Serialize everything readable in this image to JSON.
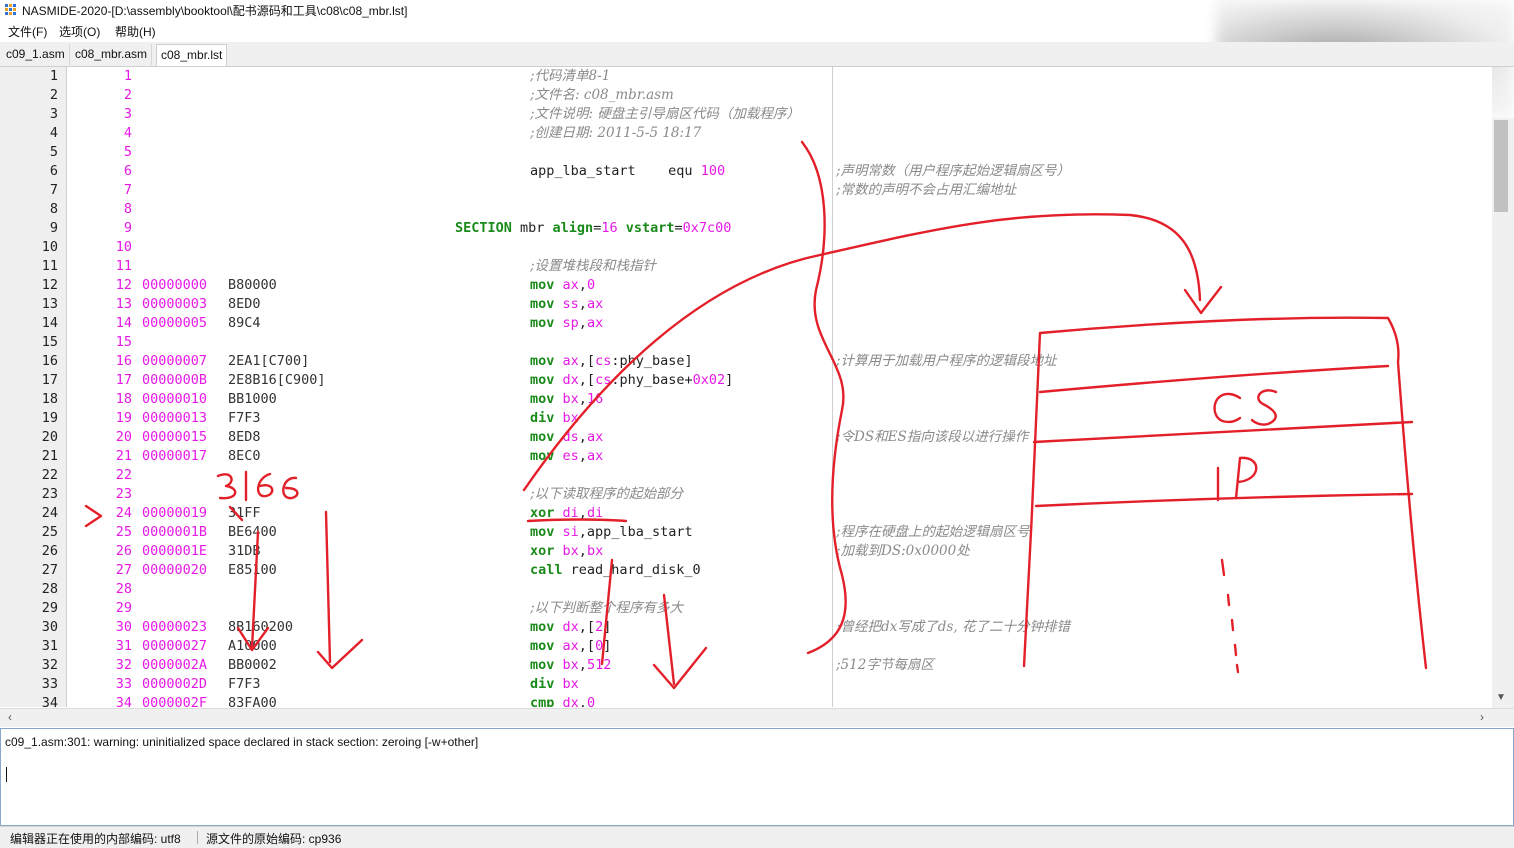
{
  "window": {
    "title": "NASMIDE-2020-[D:\\assembly\\booktool\\配书源码和工具\\c08\\c08_mbr.lst]"
  },
  "menu": [
    {
      "label": "文件(F)"
    },
    {
      "label": "选项(O)"
    },
    {
      "label": "帮助(H)"
    }
  ],
  "tabs": [
    {
      "label": "c09_1.asm",
      "active": false
    },
    {
      "label": "c08_mbr.asm",
      "active": false
    },
    {
      "label": "c08_mbr.lst",
      "active": true
    }
  ],
  "listing": [
    {
      "n": "1",
      "ln": "1",
      "addr": "",
      "hex": "",
      "src": [
        {
          "t": ";代码清单8-1",
          "c": "cm"
        }
      ],
      "cmt": ""
    },
    {
      "n": "2",
      "ln": "2",
      "addr": "",
      "hex": "",
      "src": [
        {
          "t": ";文件名: c08_mbr.asm",
          "c": "cm"
        }
      ],
      "cmt": ""
    },
    {
      "n": "3",
      "ln": "3",
      "addr": "",
      "hex": "",
      "src": [
        {
          "t": ";文件说明: 硬盘主引导扇区代码（加载程序）",
          "c": "cm"
        }
      ],
      "cmt": ""
    },
    {
      "n": "4",
      "ln": "4",
      "addr": "",
      "hex": "",
      "src": [
        {
          "t": ";创建日期: 2011-5-5 18:17",
          "c": "cm"
        }
      ],
      "cmt": ""
    },
    {
      "n": "5",
      "ln": "5",
      "addr": "",
      "hex": "",
      "src": [],
      "cmt": ""
    },
    {
      "n": "6",
      "ln": "6",
      "addr": "",
      "hex": "",
      "src": [
        {
          "t": "app_lba_start    equ ",
          "c": "tx"
        },
        {
          "t": "100",
          "c": "nm"
        }
      ],
      "cmt": ";声明常数（用户程序起始逻辑扇区号）"
    },
    {
      "n": "7",
      "ln": "7",
      "addr": "",
      "hex": "",
      "src": [],
      "cmt": ";常数的声明不会占用汇编地址"
    },
    {
      "n": "8",
      "ln": "8",
      "addr": "",
      "hex": "",
      "src": [],
      "cmt": ""
    },
    {
      "n": "9",
      "ln": "9",
      "addr": "",
      "hex": "",
      "src": [
        {
          "t": "SECTION",
          "c": "kw"
        },
        {
          "t": " mbr ",
          "c": "tx"
        },
        {
          "t": "align",
          "c": "kw"
        },
        {
          "t": "=",
          "c": "tx"
        },
        {
          "t": "16",
          "c": "nm"
        },
        {
          "t": " ",
          "c": "tx"
        },
        {
          "t": "vstart",
          "c": "kw"
        },
        {
          "t": "=",
          "c": "tx"
        },
        {
          "t": "0x7c00",
          "c": "nm"
        }
      ],
      "cmt": "",
      "section": true
    },
    {
      "n": "10",
      "ln": "10",
      "addr": "",
      "hex": "",
      "src": [],
      "cmt": ""
    },
    {
      "n": "11",
      "ln": "11",
      "addr": "",
      "hex": "",
      "src": [
        {
          "t": ";设置堆栈段和栈指针",
          "c": "cm"
        }
      ],
      "cmt": ""
    },
    {
      "n": "12",
      "ln": "12",
      "addr": "00000000",
      "hex": "B80000",
      "src": [
        {
          "t": "mov",
          "c": "kw"
        },
        {
          "t": " ",
          "c": "tx"
        },
        {
          "t": "ax",
          "c": "rg"
        },
        {
          "t": ",",
          "c": "tx"
        },
        {
          "t": "0",
          "c": "nm"
        }
      ],
      "cmt": ""
    },
    {
      "n": "13",
      "ln": "13",
      "addr": "00000003",
      "hex": "8ED0",
      "src": [
        {
          "t": "mov",
          "c": "kw"
        },
        {
          "t": " ",
          "c": "tx"
        },
        {
          "t": "ss",
          "c": "rg"
        },
        {
          "t": ",",
          "c": "tx"
        },
        {
          "t": "ax",
          "c": "rg"
        }
      ],
      "cmt": ""
    },
    {
      "n": "14",
      "ln": "14",
      "addr": "00000005",
      "hex": "89C4",
      "src": [
        {
          "t": "mov",
          "c": "kw"
        },
        {
          "t": " ",
          "c": "tx"
        },
        {
          "t": "sp",
          "c": "rg"
        },
        {
          "t": ",",
          "c": "tx"
        },
        {
          "t": "ax",
          "c": "rg"
        }
      ],
      "cmt": ""
    },
    {
      "n": "15",
      "ln": "15",
      "addr": "",
      "hex": "",
      "src": [],
      "cmt": ""
    },
    {
      "n": "16",
      "ln": "16",
      "addr": "00000007",
      "hex": "2EA1[C700]",
      "src": [
        {
          "t": "mov",
          "c": "kw"
        },
        {
          "t": " ",
          "c": "tx"
        },
        {
          "t": "ax",
          "c": "rg"
        },
        {
          "t": ",[",
          "c": "tx"
        },
        {
          "t": "cs",
          "c": "rg"
        },
        {
          "t": ":phy_base]",
          "c": "tx"
        }
      ],
      "cmt": ";计算用于加载用户程序的逻辑段地址"
    },
    {
      "n": "17",
      "ln": "17",
      "addr": "0000000B",
      "hex": "2E8B16[C900]",
      "src": [
        {
          "t": "mov",
          "c": "kw"
        },
        {
          "t": " ",
          "c": "tx"
        },
        {
          "t": "dx",
          "c": "rg"
        },
        {
          "t": ",[",
          "c": "tx"
        },
        {
          "t": "cs",
          "c": "rg"
        },
        {
          "t": ":phy_base+",
          "c": "tx"
        },
        {
          "t": "0x02",
          "c": "nm"
        },
        {
          "t": "]",
          "c": "tx"
        }
      ],
      "cmt": ""
    },
    {
      "n": "18",
      "ln": "18",
      "addr": "00000010",
      "hex": "BB1000",
      "src": [
        {
          "t": "mov",
          "c": "kw"
        },
        {
          "t": " ",
          "c": "tx"
        },
        {
          "t": "bx",
          "c": "rg"
        },
        {
          "t": ",",
          "c": "tx"
        },
        {
          "t": "16",
          "c": "nm"
        }
      ],
      "cmt": ""
    },
    {
      "n": "19",
      "ln": "19",
      "addr": "00000013",
      "hex": "F7F3",
      "src": [
        {
          "t": "div",
          "c": "kw"
        },
        {
          "t": " ",
          "c": "tx"
        },
        {
          "t": "bx",
          "c": "rg"
        }
      ],
      "cmt": ""
    },
    {
      "n": "20",
      "ln": "20",
      "addr": "00000015",
      "hex": "8ED8",
      "src": [
        {
          "t": "mov",
          "c": "kw"
        },
        {
          "t": " ",
          "c": "tx"
        },
        {
          "t": "ds",
          "c": "rg"
        },
        {
          "t": ",",
          "c": "tx"
        },
        {
          "t": "ax",
          "c": "rg"
        }
      ],
      "cmt": ";令DS和ES指向该段以进行操作"
    },
    {
      "n": "21",
      "ln": "21",
      "addr": "00000017",
      "hex": "8EC0",
      "src": [
        {
          "t": "mov",
          "c": "kw"
        },
        {
          "t": " ",
          "c": "tx"
        },
        {
          "t": "es",
          "c": "rg"
        },
        {
          "t": ",",
          "c": "tx"
        },
        {
          "t": "ax",
          "c": "rg"
        }
      ],
      "cmt": ""
    },
    {
      "n": "22",
      "ln": "22",
      "addr": "",
      "hex": "",
      "src": [],
      "cmt": ""
    },
    {
      "n": "23",
      "ln": "23",
      "addr": "",
      "hex": "",
      "src": [
        {
          "t": ";以下读取程序的起始部分",
          "c": "cm"
        }
      ],
      "cmt": ""
    },
    {
      "n": "24",
      "ln": "24",
      "addr": "00000019",
      "hex": "31FF",
      "src": [
        {
          "t": "xor",
          "c": "kw"
        },
        {
          "t": " ",
          "c": "tx"
        },
        {
          "t": "di",
          "c": "rg"
        },
        {
          "t": ",",
          "c": "tx"
        },
        {
          "t": "di",
          "c": "rg"
        }
      ],
      "cmt": ""
    },
    {
      "n": "25",
      "ln": "25",
      "addr": "0000001B",
      "hex": "BE6400",
      "src": [
        {
          "t": "mov",
          "c": "kw"
        },
        {
          "t": " ",
          "c": "tx"
        },
        {
          "t": "si",
          "c": "rg"
        },
        {
          "t": ",app_lba_start",
          "c": "tx"
        }
      ],
      "cmt": ";程序在硬盘上的起始逻辑扇区号"
    },
    {
      "n": "26",
      "ln": "26",
      "addr": "0000001E",
      "hex": "31DB",
      "src": [
        {
          "t": "xor",
          "c": "kw"
        },
        {
          "t": " ",
          "c": "tx"
        },
        {
          "t": "bx",
          "c": "rg"
        },
        {
          "t": ",",
          "c": "tx"
        },
        {
          "t": "bx",
          "c": "rg"
        }
      ],
      "cmt": ";加载到DS:0x0000处"
    },
    {
      "n": "27",
      "ln": "27",
      "addr": "00000020",
      "hex": "E85100",
      "src": [
        {
          "t": "call",
          "c": "kw"
        },
        {
          "t": " read_hard_disk_0",
          "c": "tx"
        }
      ],
      "cmt": ""
    },
    {
      "n": "28",
      "ln": "28",
      "addr": "",
      "hex": "",
      "src": [],
      "cmt": ""
    },
    {
      "n": "29",
      "ln": "29",
      "addr": "",
      "hex": "",
      "src": [
        {
          "t": ";以下判断整个程序有多大",
          "c": "cm"
        }
      ],
      "cmt": ""
    },
    {
      "n": "30",
      "ln": "30",
      "addr": "00000023",
      "hex": "8B160200",
      "src": [
        {
          "t": "mov",
          "c": "kw"
        },
        {
          "t": " ",
          "c": "tx"
        },
        {
          "t": "dx",
          "c": "rg"
        },
        {
          "t": ",[",
          "c": "tx"
        },
        {
          "t": "2",
          "c": "nm"
        },
        {
          "t": "]",
          "c": "tx"
        }
      ],
      "cmt": ";曾经把dx写成了ds, 花了二十分钟排错"
    },
    {
      "n": "31",
      "ln": "31",
      "addr": "00000027",
      "hex": "A10000",
      "src": [
        {
          "t": "mov",
          "c": "kw"
        },
        {
          "t": " ",
          "c": "tx"
        },
        {
          "t": "ax",
          "c": "rg"
        },
        {
          "t": ",[",
          "c": "tx"
        },
        {
          "t": "0",
          "c": "nm"
        },
        {
          "t": "]",
          "c": "tx"
        }
      ],
      "cmt": ""
    },
    {
      "n": "32",
      "ln": "32",
      "addr": "0000002A",
      "hex": "BB0002",
      "src": [
        {
          "t": "mov",
          "c": "kw"
        },
        {
          "t": " ",
          "c": "tx"
        },
        {
          "t": "bx",
          "c": "rg"
        },
        {
          "t": ",",
          "c": "tx"
        },
        {
          "t": "512",
          "c": "nm"
        }
      ],
      "cmt": ";512字节每扇区"
    },
    {
      "n": "33",
      "ln": "33",
      "addr": "0000002D",
      "hex": "F7F3",
      "src": [
        {
          "t": "div",
          "c": "kw"
        },
        {
          "t": " ",
          "c": "tx"
        },
        {
          "t": "bx",
          "c": "rg"
        }
      ],
      "cmt": ""
    },
    {
      "n": "34",
      "ln": "34",
      "addr": "0000002F",
      "hex": "83FA00",
      "src": [
        {
          "t": "cmp",
          "c": "kw"
        },
        {
          "t": " ",
          "c": "tx"
        },
        {
          "t": "dx",
          "c": "rg"
        },
        {
          "t": ",",
          "c": "tx"
        },
        {
          "t": "0",
          "c": "nm"
        }
      ],
      "cmt": ""
    }
  ],
  "annotations": {
    "ink_color": "#e3202a",
    "handwritten": [
      "3166",
      "CS",
      "IP",
      ">"
    ]
  },
  "output": {
    "message": "c09_1.asm:301: warning: uninitialized space declared in stack section: zeroing [-w+other]"
  },
  "status": {
    "editor_encoding": "编辑器正在使用的内部编码: utf8",
    "source_encoding": "源文件的原始编码: cp936"
  }
}
